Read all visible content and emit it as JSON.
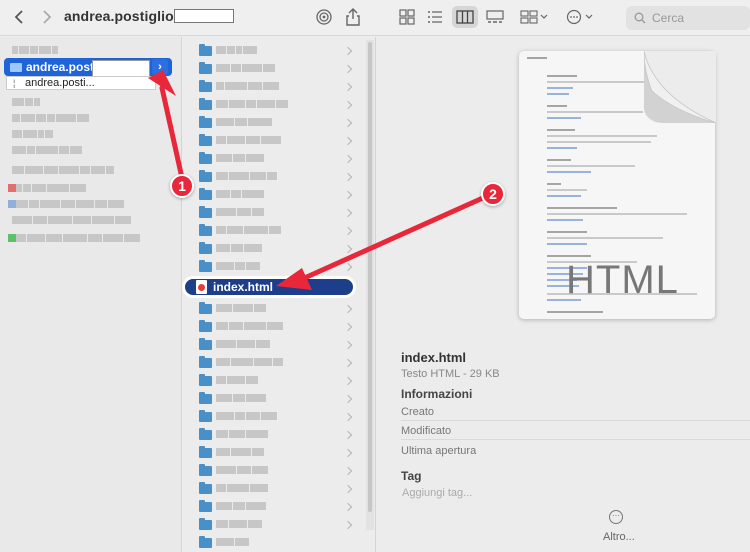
{
  "toolbar": {
    "title": "andrea.postiglione_",
    "search_placeholder": "Cerca",
    "back_icon": "chevron-left-icon",
    "forward_icon": "chevron-right-icon"
  },
  "sidebar": {
    "selected_folder_label": "andrea.posti...",
    "drag_label": "andrea.posti..."
  },
  "file_list": {
    "selected_file_label": "index.html"
  },
  "preview": {
    "doc_text": "HTML",
    "file_name": "index.html",
    "file_type": "Testo HTML - 29 KB",
    "info_heading": "Informazioni",
    "created_label": "Creato",
    "modified_label": "Modificato",
    "last_opened_label": "Ultima apertura",
    "tag_heading": "Tag",
    "tag_placeholder": "Aggiungi tag...",
    "more_label": "Altro..."
  },
  "annotations": {
    "badge_1": "1",
    "badge_2": "2",
    "arrow_color": "#e8273b"
  },
  "colors": {
    "selection_blue": "#1f63d8",
    "selected_file_bg": "#1d3e8a",
    "folder_blue": "#4a90c8"
  }
}
